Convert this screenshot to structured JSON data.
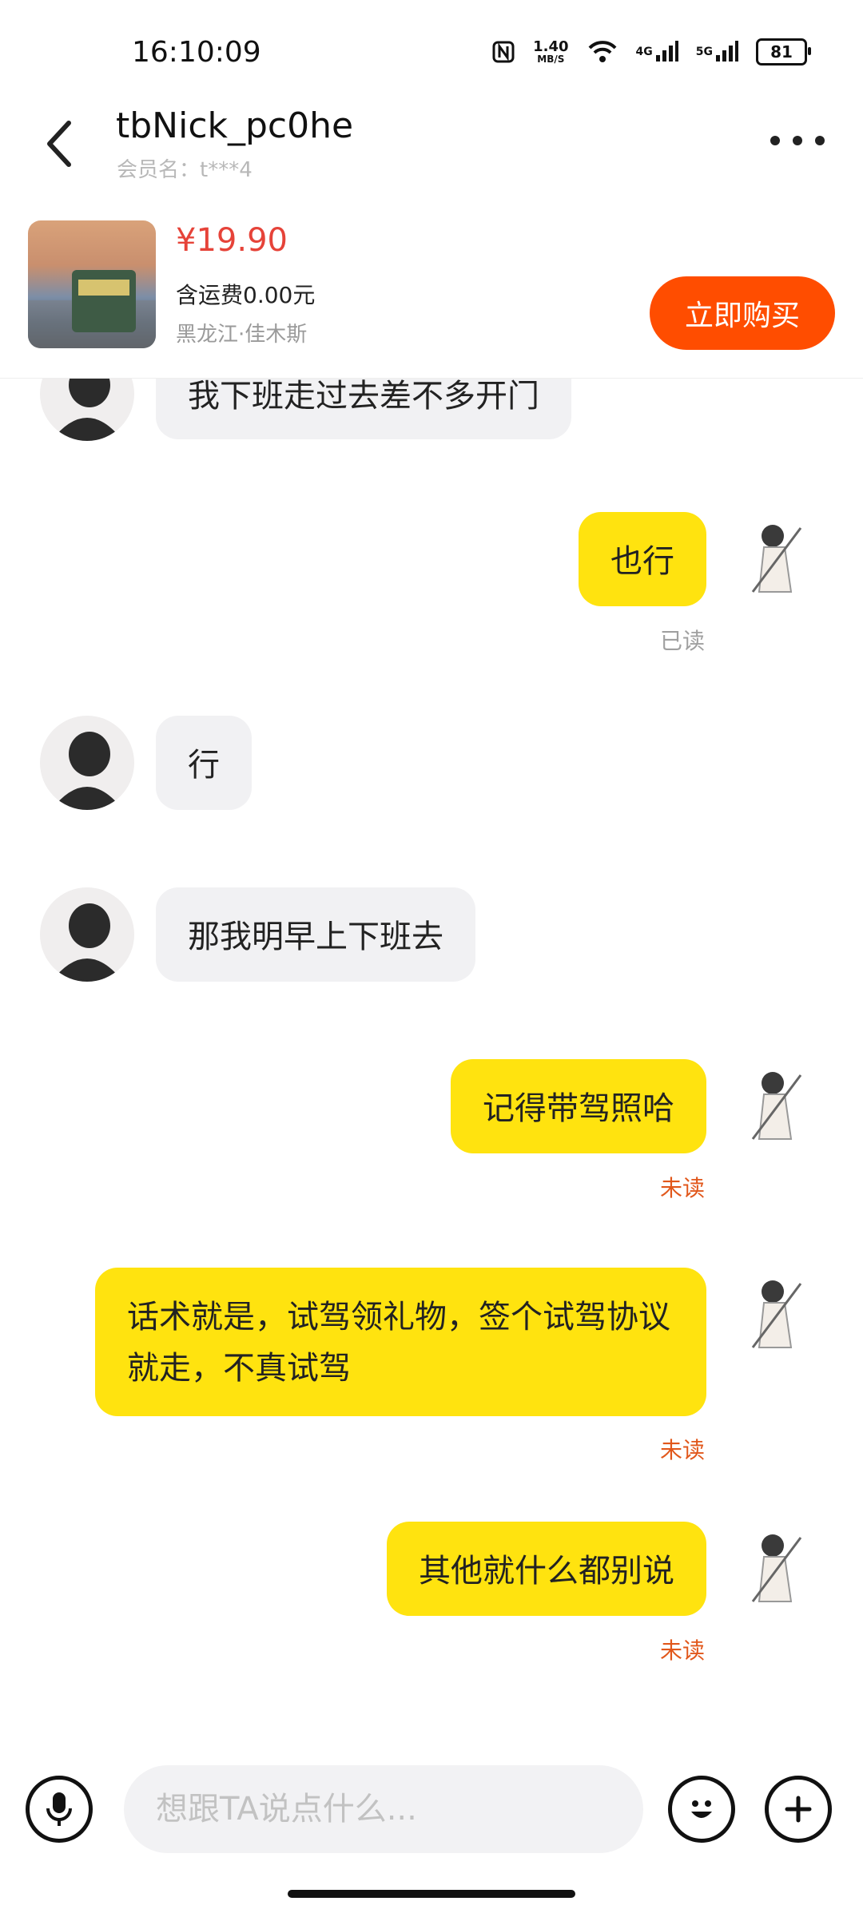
{
  "status_bar": {
    "time": "16:10:09",
    "speed_value": "1.40",
    "speed_unit": "MB/S",
    "network_1": "4G",
    "network_2": "5G",
    "battery": "81"
  },
  "header": {
    "title": "tbNick_pc0he",
    "subtitle": "会员名：t***4"
  },
  "product": {
    "price": "¥19.90",
    "shipping": "含运费0.00元",
    "location": "黑龙江·佳木斯",
    "buy_label": "立即购买"
  },
  "messages": [
    {
      "side": "in",
      "text": "我下班走过去差不多开门"
    },
    {
      "side": "out",
      "text": "也行",
      "status": "已读"
    },
    {
      "side": "in",
      "text": "行"
    },
    {
      "side": "in",
      "text": "那我明早上下班去"
    },
    {
      "side": "out",
      "text": "记得带驾照哈",
      "status": "未读"
    },
    {
      "side": "out",
      "text": "话术就是，试驾领礼物，签个试驾协议就走，不真试驾",
      "status": "未读"
    },
    {
      "side": "out",
      "text": "其他就什么都别说",
      "status": "未读"
    }
  ],
  "input": {
    "placeholder": "想跟TA说点什么..."
  },
  "colors": {
    "buy_button": "#ff4d00",
    "price": "#e64339",
    "outgoing_bubble": "#ffe30f",
    "incoming_bubble": "#f1f1f3",
    "unread": "#e1571b"
  }
}
